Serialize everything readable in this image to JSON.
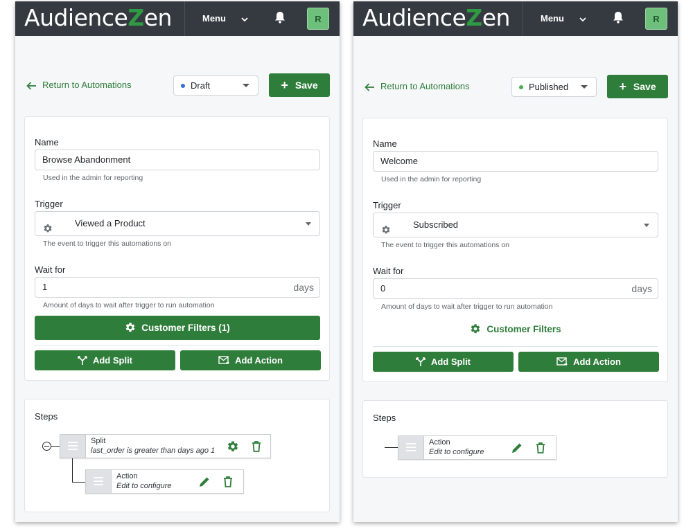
{
  "app": {
    "logo_prefix": "Audience",
    "logo_z": "Z",
    "logo_suffix": "en",
    "menu_label": "Menu",
    "avatar_initial": "R"
  },
  "colors": {
    "primary_green": "#2e7d3a",
    "topbar": "#353a40",
    "draft_dot": "#2f6fd6",
    "published_dot": "#4caf50"
  },
  "common": {
    "return_label": "Return to Automations",
    "save_label": "Save",
    "name_label": "Name",
    "name_hint": "Used in the admin for reporting",
    "trigger_label": "Trigger",
    "trigger_hint": "The event to trigger this automations on",
    "wait_label": "Wait for",
    "wait_suffix": "days",
    "wait_hint": "Amount of days to wait after trigger to run automation",
    "add_split_label": "Add Split",
    "add_action_label": "Add Action",
    "steps_label": "Steps"
  },
  "left": {
    "status": "Draft",
    "name_value": "Browse Abandonment",
    "trigger_value": "Viewed a Product",
    "wait_value": "1",
    "filters_label": "Customer Filters (1)",
    "steps": [
      {
        "title": "Split",
        "subtitle": "last_order is greater than days ago 1",
        "icons": [
          "gear-icon",
          "trash-icon"
        ]
      },
      {
        "title": "Action",
        "subtitle": "Edit to configure",
        "icons": [
          "pencil-icon",
          "trash-icon"
        ]
      }
    ]
  },
  "right": {
    "status": "Published",
    "name_value": "Welcome",
    "trigger_value": "Subscribed",
    "wait_value": "0",
    "filters_label": "Customer Filters",
    "steps": [
      {
        "title": "Action",
        "subtitle": "Edit to configure",
        "icons": [
          "pencil-icon",
          "trash-icon"
        ]
      }
    ]
  }
}
